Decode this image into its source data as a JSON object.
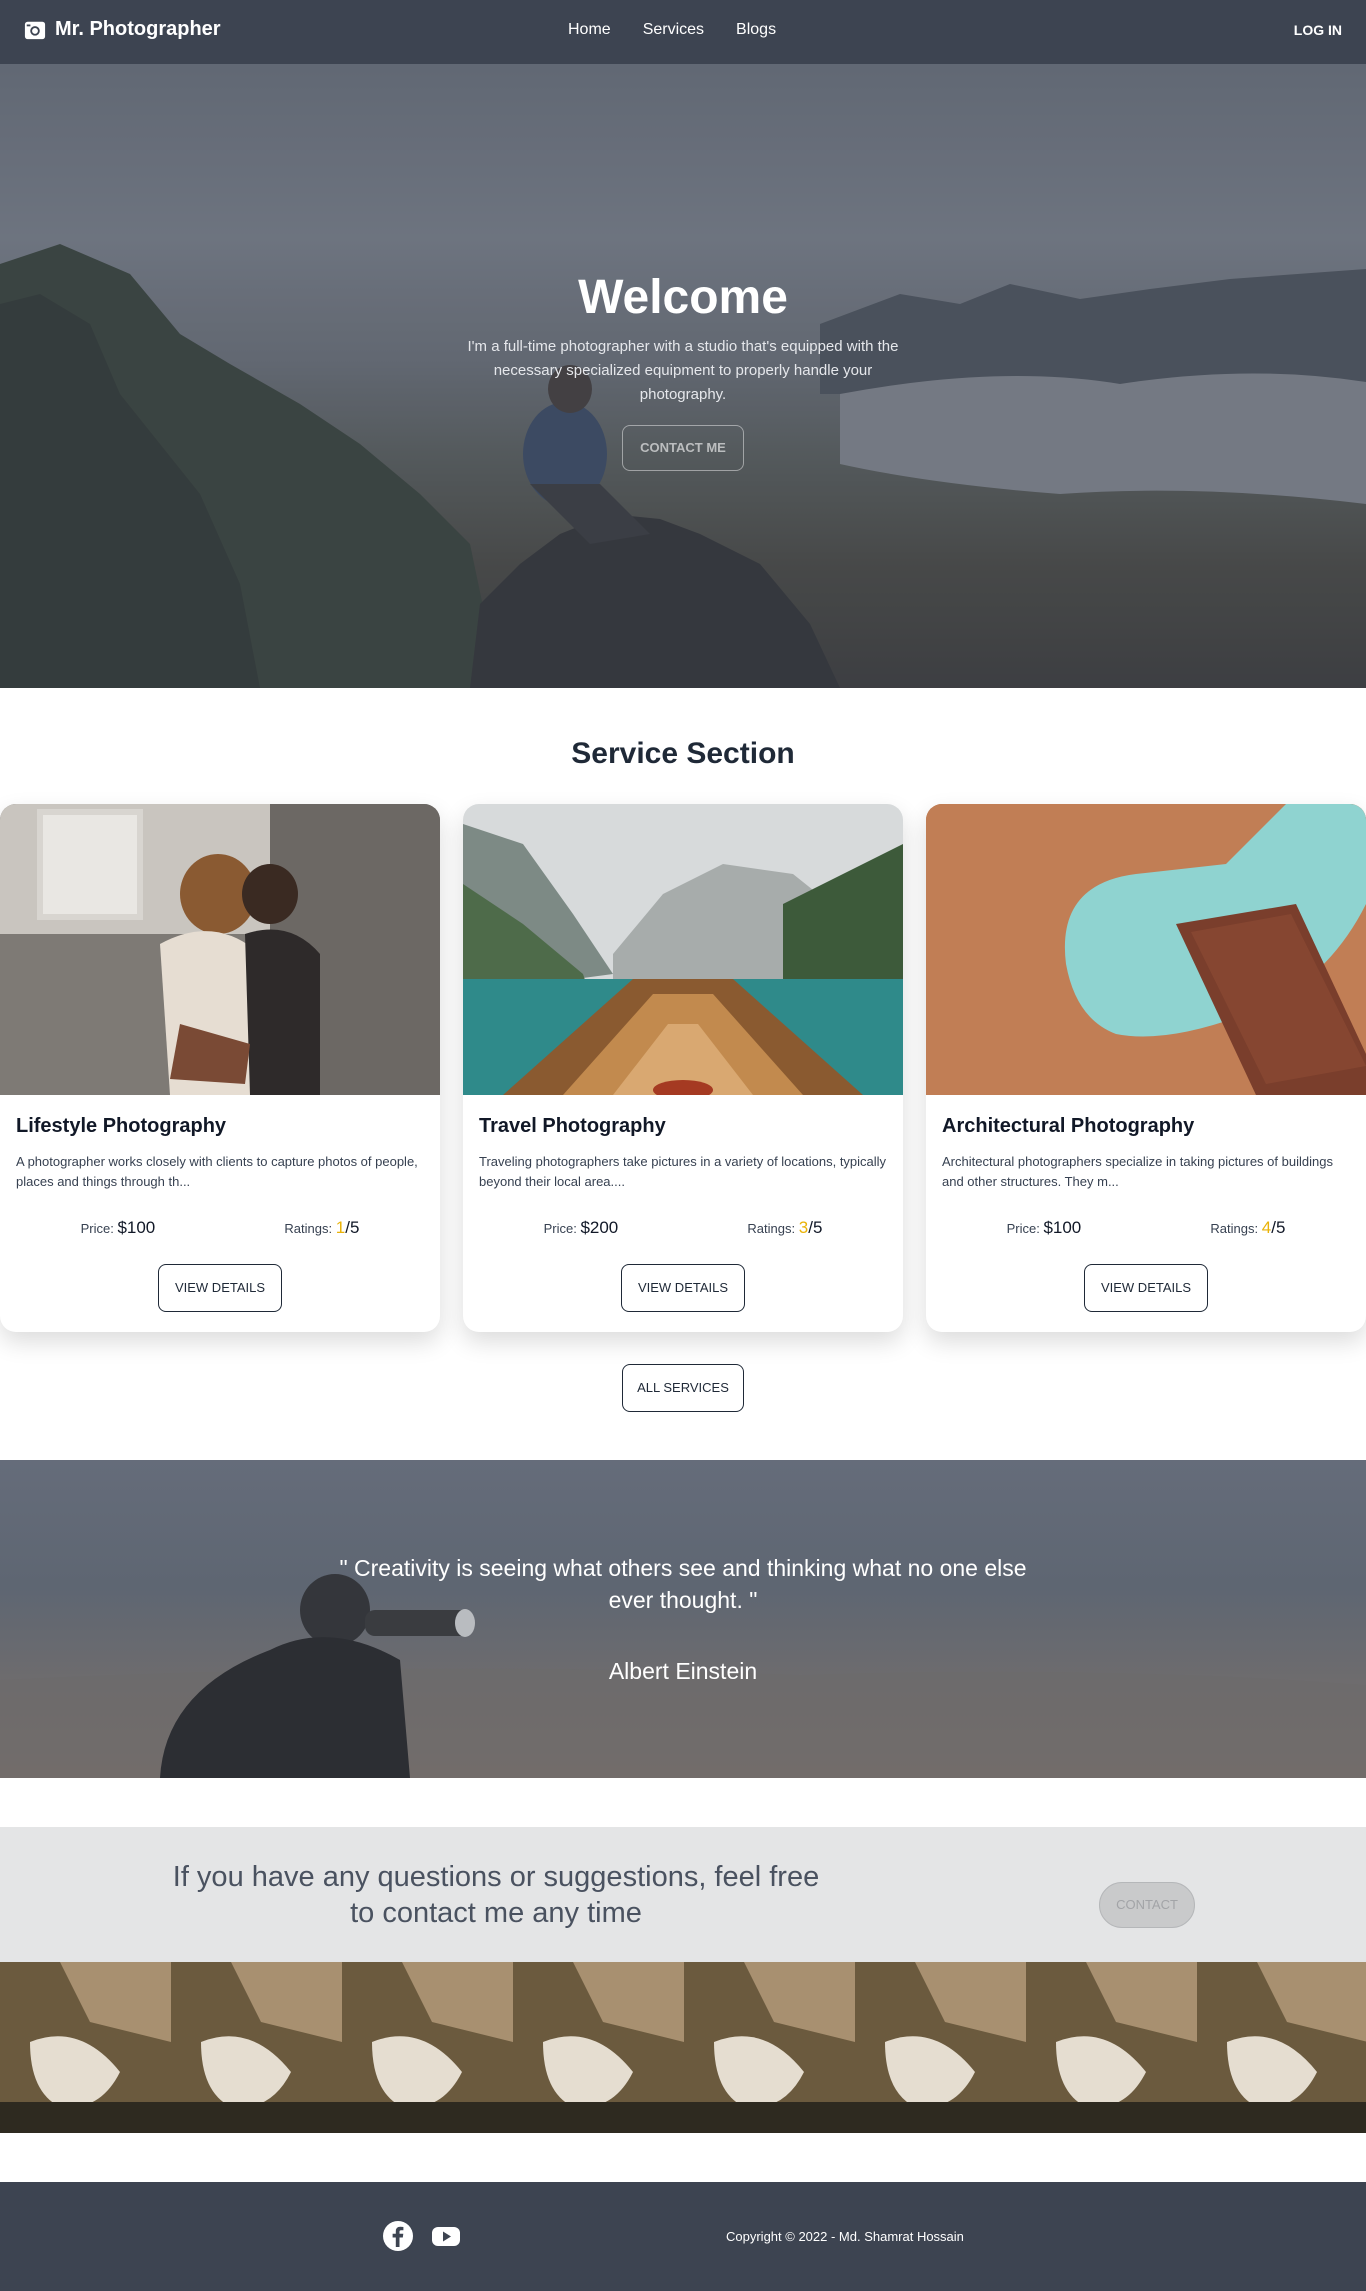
{
  "navbar": {
    "brand": "Mr. Photographer",
    "links": [
      "Home",
      "Services",
      "Blogs"
    ],
    "login": "Log In"
  },
  "hero": {
    "title": "Welcome",
    "text": "I'm a full-time photographer with a studio that's equipped with the necessary specialized equipment to properly handle your photography.",
    "button": "Contact Me"
  },
  "services": {
    "title": "Service Section",
    "price_label": "Price:",
    "ratings_label": "Ratings:",
    "rating_out_of": "/5",
    "button": "View Details",
    "items": [
      {
        "title": "Lifestyle Photography",
        "description": "A photographer works closely with clients to capture photos of people, places and things through th...",
        "price": "$100",
        "rating": "1"
      },
      {
        "title": "Travel Photography",
        "description": "Traveling photographers take pictures in a variety of locations, typically beyond their local area....",
        "price": "$200",
        "rating": "3"
      },
      {
        "title": "Architectural Photography",
        "description": "Architectural photographers specialize in taking pictures of buildings and other structures. They m...",
        "price": "$100",
        "rating": "4"
      }
    ],
    "all_button": "All Services"
  },
  "quote": {
    "text": "\" Creativity is seeing what others see and thinking what no one else ever thought. \"",
    "author": "Albert Einstein"
  },
  "contact": {
    "text": "If you have any questions or suggestions, feel free to contact me any time",
    "button": "Contact"
  },
  "footer": {
    "icons": [
      "facebook-icon",
      "youtube-icon"
    ],
    "copyright": "Copyright © 2022 - Md. Shamrat Hossain"
  },
  "colors": {
    "navbar": "#3d4451",
    "footer": "#3d4451",
    "rating": "#eab308",
    "contact_band": "#e4e5e6"
  }
}
